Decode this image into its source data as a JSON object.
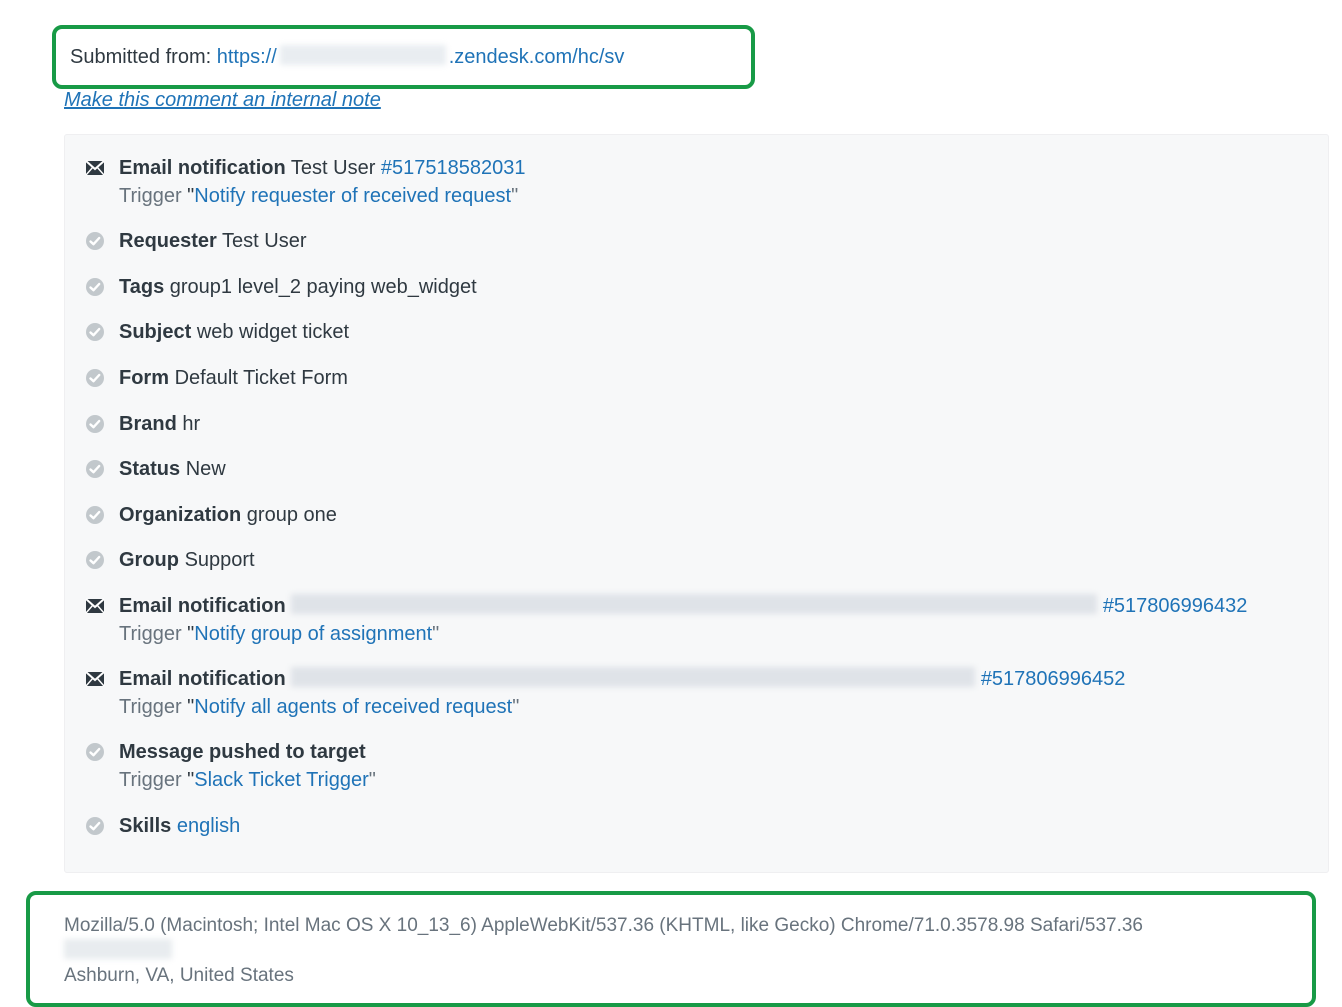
{
  "colors": {
    "accent_green": "#189a46",
    "link": "#1f73b7"
  },
  "submitted": {
    "prefix": "Submitted from: ",
    "url_left": "https://",
    "url_right": ".zendesk.com/hc/sv"
  },
  "internal_note_link": "Make this comment an internal note",
  "events": [
    {
      "type": "mail",
      "label": "Email notification",
      "value": "Test User",
      "id": "#517518582031",
      "sub_prefix": "Trigger",
      "sub_link": "Notify requester of received request"
    },
    {
      "type": "check",
      "label": "Requester",
      "value": "Test User"
    },
    {
      "type": "check",
      "label": "Tags",
      "value": "group1 level_2 paying web_widget"
    },
    {
      "type": "check",
      "label": "Subject",
      "value": "web widget ticket"
    },
    {
      "type": "check",
      "label": "Form",
      "value": "Default Ticket Form"
    },
    {
      "type": "check",
      "label": "Brand",
      "value": "hr"
    },
    {
      "type": "check",
      "label": "Status",
      "value": "New"
    },
    {
      "type": "check",
      "label": "Organization",
      "value": "group one"
    },
    {
      "type": "check",
      "label": "Group",
      "value": "Support"
    },
    {
      "type": "mail",
      "label": "Email notification",
      "redact_width": 806,
      "id": "#517806996432",
      "sub_prefix": "Trigger",
      "sub_link": "Notify group of assignment"
    },
    {
      "type": "mail",
      "label": "Email notification",
      "redact_width": 684,
      "id": "#517806996452",
      "sub_prefix": "Trigger",
      "sub_link": "Notify all agents of received request"
    },
    {
      "type": "check",
      "label": "Message pushed to target",
      "sub_prefix": "Trigger",
      "sub_link": "Slack Ticket Trigger"
    },
    {
      "type": "check",
      "label": "Skills",
      "value_is_link": true,
      "value": "english"
    }
  ],
  "footer": {
    "user_agent": "Mozilla/5.0 (Macintosh; Intel Mac OS X 10_13_6) AppleWebKit/537.36 (KHTML, like Gecko) Chrome/71.0.3578.98 Safari/537.36",
    "location": "Ashburn, VA, United States"
  }
}
